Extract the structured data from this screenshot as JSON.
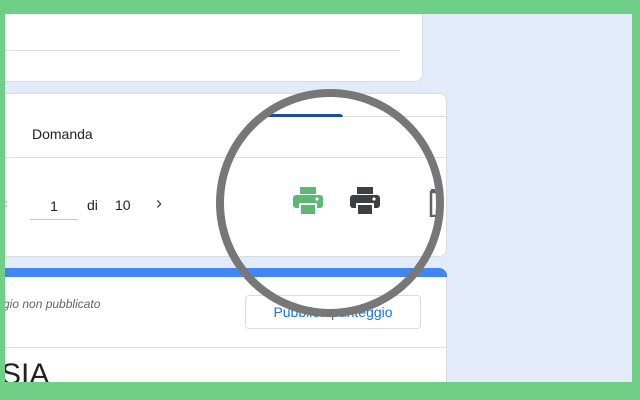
{
  "tabs": {
    "question_label": "Domanda"
  },
  "pager": {
    "current_page": "1",
    "of_label": "di",
    "total_pages": "10",
    "prev_glyph": "‹",
    "next_glyph": "›"
  },
  "score": {
    "status_text": "gio non pubblicato",
    "publish_label": "Pubblica punteggio"
  },
  "partial_title": "SIA",
  "icons": {
    "print_green_color": "#5cb873",
    "print_dark_color": "#3c4043",
    "trash_color": "#5f6368"
  },
  "colors": {
    "background_border": "#6fcf86",
    "panel_bg": "#e3ebfb",
    "accent_blue": "#4285f4",
    "tab_underline": "#1a4ba8",
    "magnifier_ring": "#777777"
  }
}
